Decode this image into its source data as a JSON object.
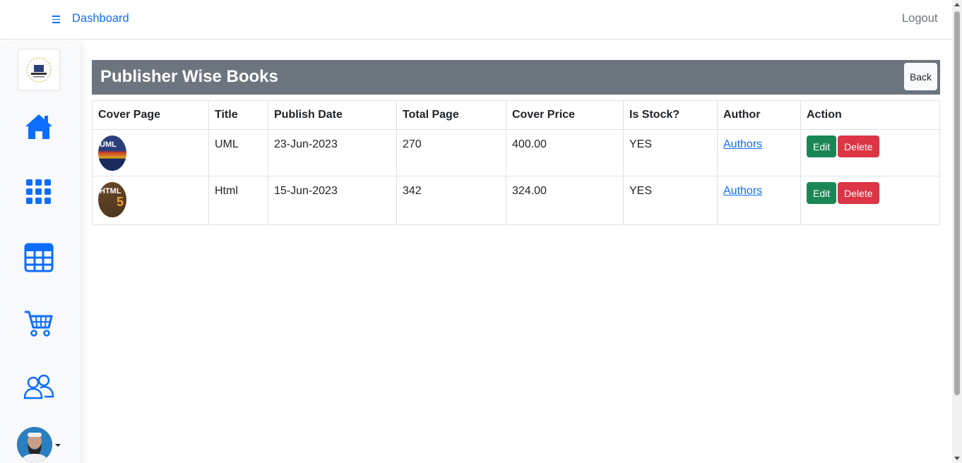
{
  "navbar": {
    "title": "Dashboard",
    "logout_label": "Logout"
  },
  "sidebar": {
    "items": [
      {
        "icon": "house-icon"
      },
      {
        "icon": "grid-icon"
      },
      {
        "icon": "table-icon"
      },
      {
        "icon": "cart-icon"
      },
      {
        "icon": "people-icon"
      }
    ]
  },
  "page": {
    "title": "Publisher Wise Books",
    "back_label": "Back"
  },
  "table": {
    "headers": [
      "Cover Page",
      "Title",
      "Publish Date",
      "Total Page",
      "Cover Price",
      "Is Stock?",
      "Author",
      "Action"
    ],
    "rows": [
      {
        "cover_text": "UML",
        "title": "UML",
        "publish_date": "23-Jun-2023",
        "total_page": "270",
        "cover_price": "400.00",
        "is_stock": "YES",
        "author": "Authors",
        "edit": "Edit",
        "delete": "Delete"
      },
      {
        "cover_text": "HTML",
        "title": "Html",
        "publish_date": "15-Jun-2023",
        "total_page": "342",
        "cover_price": "324.00",
        "is_stock": "YES",
        "author": "Authors",
        "edit": "Edit",
        "delete": "Delete"
      }
    ]
  },
  "colors": {
    "primary": "#0d6efd",
    "header_bg": "#6c757d",
    "edit": "#198754",
    "delete": "#dc3545"
  }
}
